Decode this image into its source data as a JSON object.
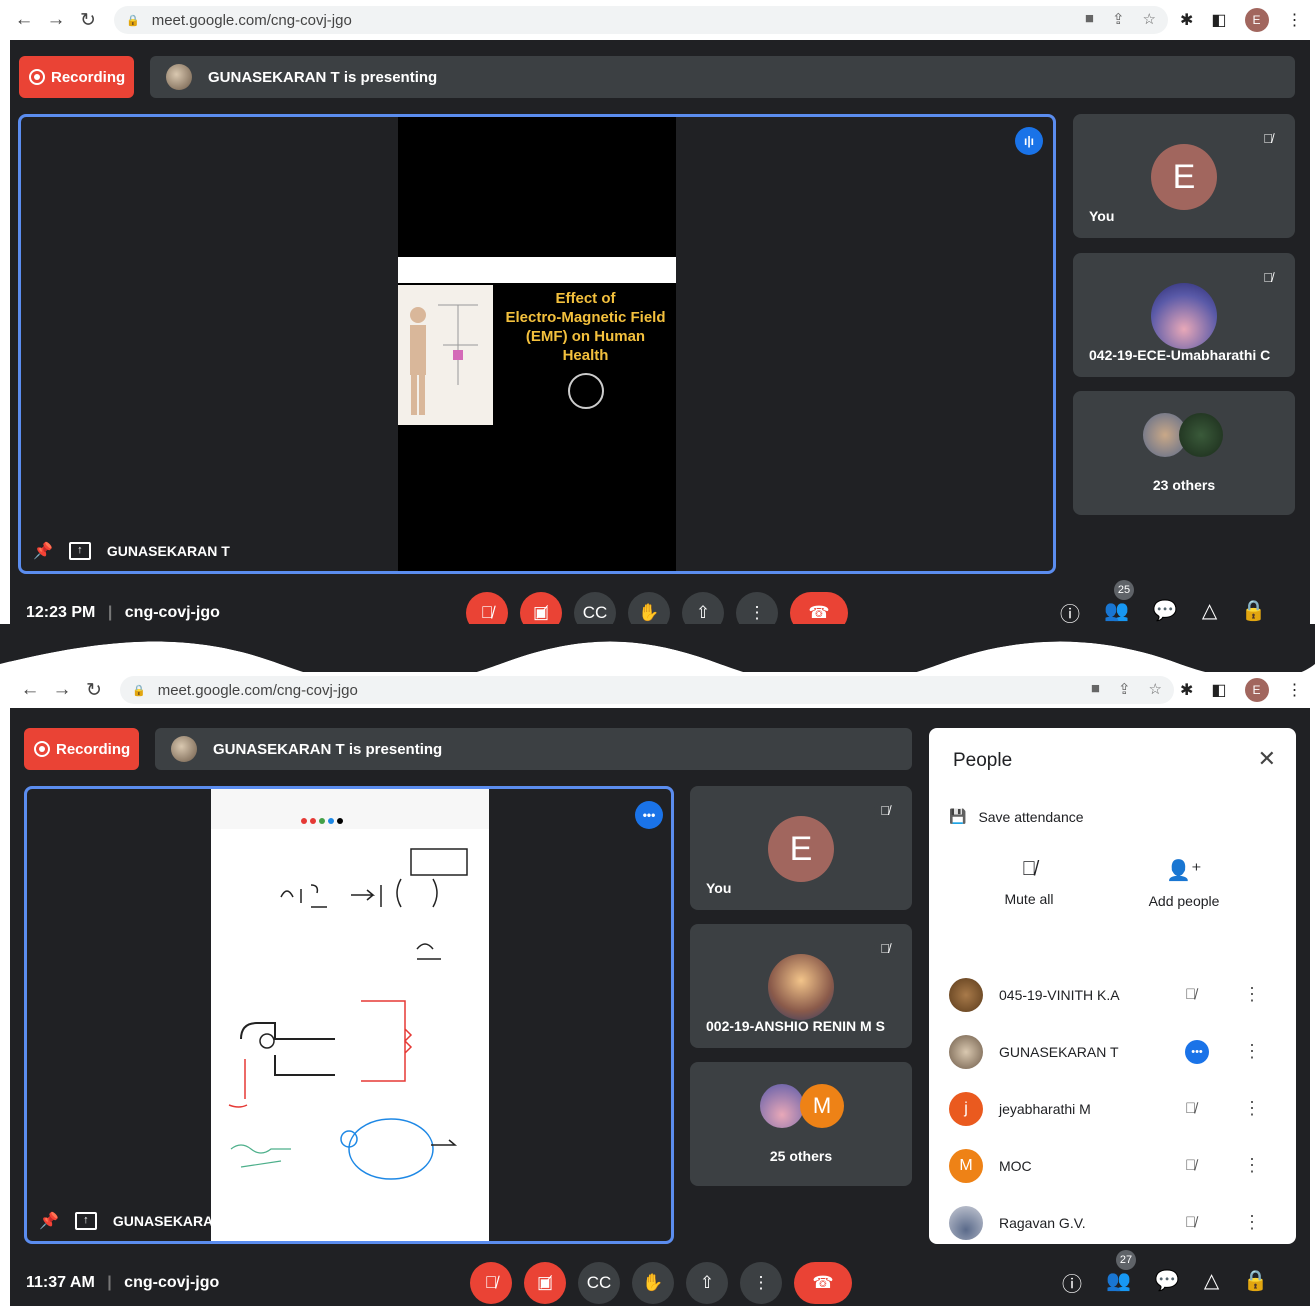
{
  "browser": {
    "url": "meet.google.com/cng-covj-jgo",
    "profile_initial": "E"
  },
  "shot1": {
    "recording_label": "Recording",
    "presenting_text": "GUNASEKARAN T is presenting",
    "slide": {
      "title_lines": [
        "Effect of",
        "Electro-Magnetic Field",
        "(EMF) on Human",
        "Health"
      ]
    },
    "presenter_name": "GUNASEKARAN T",
    "tiles": [
      {
        "name": "You",
        "initial": "E"
      },
      {
        "name": "042-19-ECE-Umabharathi C"
      },
      {
        "name": "23 others"
      }
    ],
    "time": "12:23 PM",
    "meeting_code": "cng-covj-jgo",
    "people_count": "25"
  },
  "shot2": {
    "recording_label": "Recording",
    "presenting_text": "GUNASEKARAN T is presenting",
    "presenter_name": "GUNASEKARAN T",
    "tiles": [
      {
        "name": "You",
        "initial": "E"
      },
      {
        "name": "002-19-ANSHIO RENIN M S"
      },
      {
        "name": "25 others",
        "initial": "M"
      }
    ],
    "time": "11:37 AM",
    "meeting_code": "cng-covj-jgo",
    "people_count": "27",
    "people_panel": {
      "title": "People",
      "save_attendance": "Save attendance",
      "mute_all": "Mute all",
      "add_people": "Add people",
      "participants": [
        {
          "name": "045-19-VINITH K.A",
          "color": "#7a4a2a",
          "initial": ""
        },
        {
          "name": "GUNASEKARAN T",
          "color": "#8a9aa8",
          "initial": ""
        },
        {
          "name": "jeyabharathi M",
          "color": "#ea5a1f",
          "initial": "j"
        },
        {
          "name": "MOC",
          "color": "#ee8216",
          "initial": "M"
        },
        {
          "name": "Ragavan G.V.",
          "color": "#c9ccd6",
          "initial": ""
        }
      ]
    }
  },
  "colors": {
    "meet_bg": "#202124",
    "tile_bg": "#3c4043",
    "red": "#ea4335",
    "blue": "#1a73e8"
  }
}
